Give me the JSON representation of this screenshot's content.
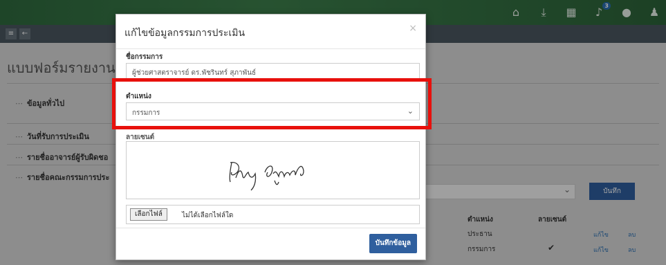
{
  "topbar": {
    "icons": [
      "home-icon",
      "download-icon",
      "calendar-icon",
      "bell-icon",
      "chat-icon",
      "user-icon"
    ],
    "notification_count": "3"
  },
  "page": {
    "title": "แบบฟอร์มรายงานผ",
    "sections": [
      "ข้อมูลทั่วไป",
      "วันที่รับการประเมิน",
      "รายชื่ออาจารย์ผู้รับผิดชอ",
      "รายชื่อคณะกรรมการประ"
    ],
    "save_label": "บันทึก",
    "table": {
      "headers": [
        "ตำแหน่ง",
        "ลายเซนต์"
      ],
      "rows": [
        {
          "position": "ประธาน",
          "signed": false,
          "edit": "แก้ไข",
          "delete": "ลบ"
        },
        {
          "position": "กรรมการ",
          "signed": true,
          "edit": "แก้ไข",
          "delete": "ลบ"
        }
      ]
    }
  },
  "modal": {
    "title": "แก้ไขข้อมูลกรรมการประเมิน",
    "close": "×",
    "name_label": "ชื่อกรรมการ",
    "name_value": "ผู้ช่วยศาสตราจารย์ ดร.พัชรินทร์ สุภาพันธ์",
    "position_label": "ตำแหน่ง",
    "position_value": "กรรมการ",
    "signature_label": "ลายเซนต์",
    "file_button": "เลือกไฟล์",
    "file_status": "ไม่ได้เลือกไฟล์ใด",
    "save_label": "บันทึกข้อมูล"
  },
  "colors": {
    "topbar": "#3d7f4c",
    "primary_button": "#2f5f9e",
    "highlight": "#e8100c"
  }
}
